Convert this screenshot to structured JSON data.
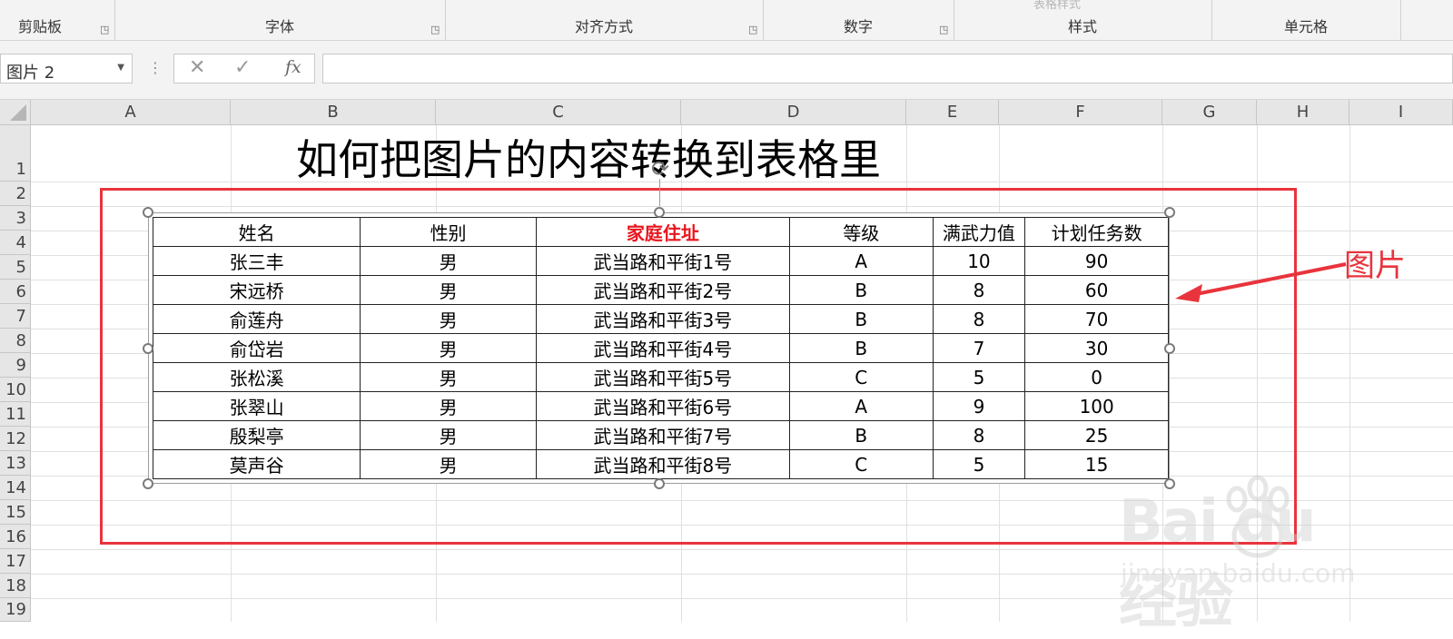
{
  "ribbon": {
    "faded_label": "表格样式",
    "groups": [
      {
        "label": "剪贴板",
        "launcher": true
      },
      {
        "label": "字体",
        "launcher": true
      },
      {
        "label": "对齐方式",
        "launcher": true
      },
      {
        "label": "数字",
        "launcher": true
      },
      {
        "label": "样式",
        "launcher": false
      },
      {
        "label": "单元格",
        "launcher": false
      }
    ]
  },
  "formula_bar": {
    "name_box": "图片 2",
    "cancel_icon": "✕",
    "enter_icon": "✓",
    "fx_label": "fx",
    "formula": ""
  },
  "sheet": {
    "columns": [
      "A",
      "B",
      "C",
      "D",
      "E",
      "F",
      "G",
      "H",
      "I"
    ],
    "rows": [
      "1",
      "2",
      "3",
      "4",
      "5",
      "6",
      "7",
      "8",
      "9",
      "10",
      "11",
      "12",
      "13",
      "14",
      "15",
      "16",
      "17",
      "18",
      "19"
    ],
    "title": "如何把图片的内容转换到表格里"
  },
  "picture": {
    "headers": [
      "姓名",
      "性别",
      "家庭住址",
      "等级",
      "满武力值",
      "计划任务数"
    ],
    "highlight_header": "家庭住址",
    "highlight_color": "#e8141c",
    "rows": [
      [
        "张三丰",
        "男",
        "武当路和平街1号",
        "A",
        "10",
        "90"
      ],
      [
        "宋远桥",
        "男",
        "武当路和平街2号",
        "B",
        "8",
        "60"
      ],
      [
        "俞莲舟",
        "男",
        "武当路和平街3号",
        "B",
        "8",
        "70"
      ],
      [
        "俞岱岩",
        "男",
        "武当路和平街4号",
        "B",
        "7",
        "30"
      ],
      [
        "张松溪",
        "男",
        "武当路和平街5号",
        "C",
        "5",
        "0"
      ],
      [
        "张翠山",
        "男",
        "武当路和平街6号",
        "A",
        "9",
        "100"
      ],
      [
        "殷梨亭",
        "男",
        "武当路和平街7号",
        "B",
        "8",
        "25"
      ],
      [
        "莫声谷",
        "男",
        "武当路和平街8号",
        "C",
        "5",
        "15"
      ]
    ]
  },
  "annotation": {
    "label": "图片",
    "color": "#e8343d"
  },
  "watermark": {
    "logo": "Bai du 经验",
    "url": "jingyan.baidu.com"
  }
}
